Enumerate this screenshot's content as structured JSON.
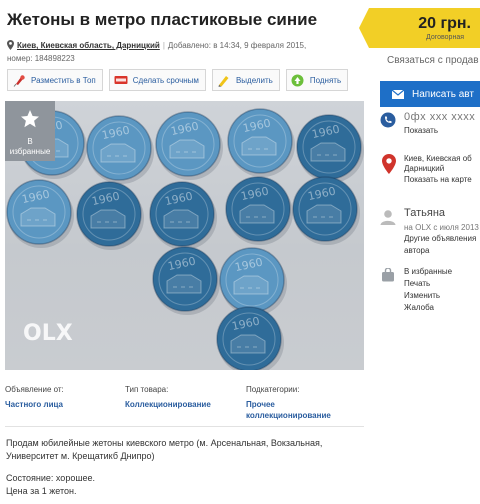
{
  "listing": {
    "title": "Жетоны в метро пластиковые синие",
    "price": "20 грн.",
    "price_note": "Договорная",
    "location": "Киев, Киевская область, Дарницкий",
    "added": "Добавлено: в 14:34, 9 февраля 2015,",
    "number": "номер: 184898223"
  },
  "actions": [
    {
      "label": "Разместить в Топ",
      "icon": "top-pin-icon"
    },
    {
      "label": "Сделать срочным",
      "icon": "urgent-tag-icon"
    },
    {
      "label": "Выделить",
      "icon": "highlighter-icon"
    },
    {
      "label": "Поднять",
      "icon": "raise-icon"
    }
  ],
  "photo": {
    "favorite_label_1": "В",
    "favorite_label_2": "избранные",
    "watermark": "OLX",
    "token_years": [
      "1960",
      "1960",
      "1960",
      "1960",
      "1960",
      "1960",
      "1960",
      "1960",
      "1960",
      "1960",
      "1960",
      "1960",
      "1960"
    ],
    "colors": {
      "light_token": "#5b97c2",
      "dark_token": "#2f6c99"
    }
  },
  "details": {
    "ad_from_label": "Объявление от:",
    "ad_from_value": "Частного лица",
    "type_label": "Тип товара:",
    "type_value": "Коллекционирование",
    "subcat_label": "Подкатегории:",
    "subcat_value_1": "Прочее",
    "subcat_value_2": "коллекционирование"
  },
  "description": {
    "p1_line1": "Продам юбилейные жетоны киевского метро (м. Арсенальная, Вокзальная,",
    "p1_line2": "Университет м. Крещатикб Днипро)",
    "p2_line1": "Состояние: хорошее.",
    "p2_line2": "Цена за 1 жетон."
  },
  "sidebar": {
    "contact_hint": "Связаться с продав",
    "message_button": "Написать авт",
    "phone": "0фх ххх хххх",
    "show_phone": "Показать",
    "addr_line1": "Киев, Киевская об",
    "addr_line2": "Дарницкий",
    "show_on_map": "Показать на карте",
    "user_name": "Татьяна",
    "since": "на OLX с июля 2013",
    "other_ads_1": "Другие объявления",
    "other_ads_2": "автора",
    "to_favorites": "В избранные",
    "print": "Печать",
    "edit": "Изменить",
    "report": "Жалоба"
  },
  "colors": {
    "accent_yellow": "#f2cf26",
    "link_blue": "#2a5d9f",
    "button_blue": "#1e6fc7",
    "report_red": "#d0342c"
  }
}
